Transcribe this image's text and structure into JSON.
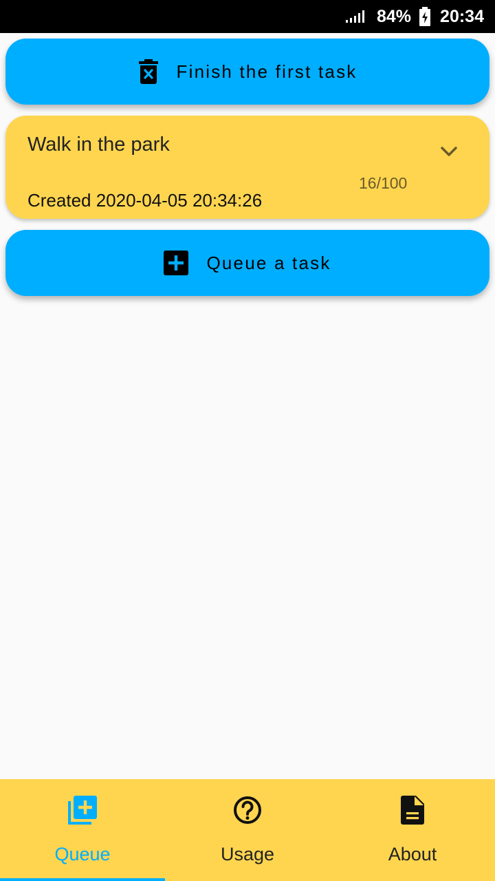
{
  "status_bar": {
    "battery_percent": "84%",
    "time": "20:34",
    "icons": [
      "signal-icon",
      "battery-charging-icon"
    ]
  },
  "actions": {
    "finish_label": "Finish the first task",
    "finish_icon": "delete-forever-icon",
    "queue_label": "Queue a task",
    "queue_icon": "add-box-icon"
  },
  "task": {
    "title": "Walk in the park",
    "counter": "16/100",
    "created": "Created 2020-04-05 20:34:26",
    "expand_icon": "chevron-down-icon"
  },
  "nav": {
    "items": [
      {
        "label": "Queue",
        "icon": "library-add-icon",
        "active": true
      },
      {
        "label": "Usage",
        "icon": "help-outline-icon",
        "active": false
      },
      {
        "label": "About",
        "icon": "description-icon",
        "active": false
      }
    ]
  },
  "colors": {
    "accent": "#00aeff",
    "card": "#ffd54f",
    "background": "#fafafa"
  }
}
